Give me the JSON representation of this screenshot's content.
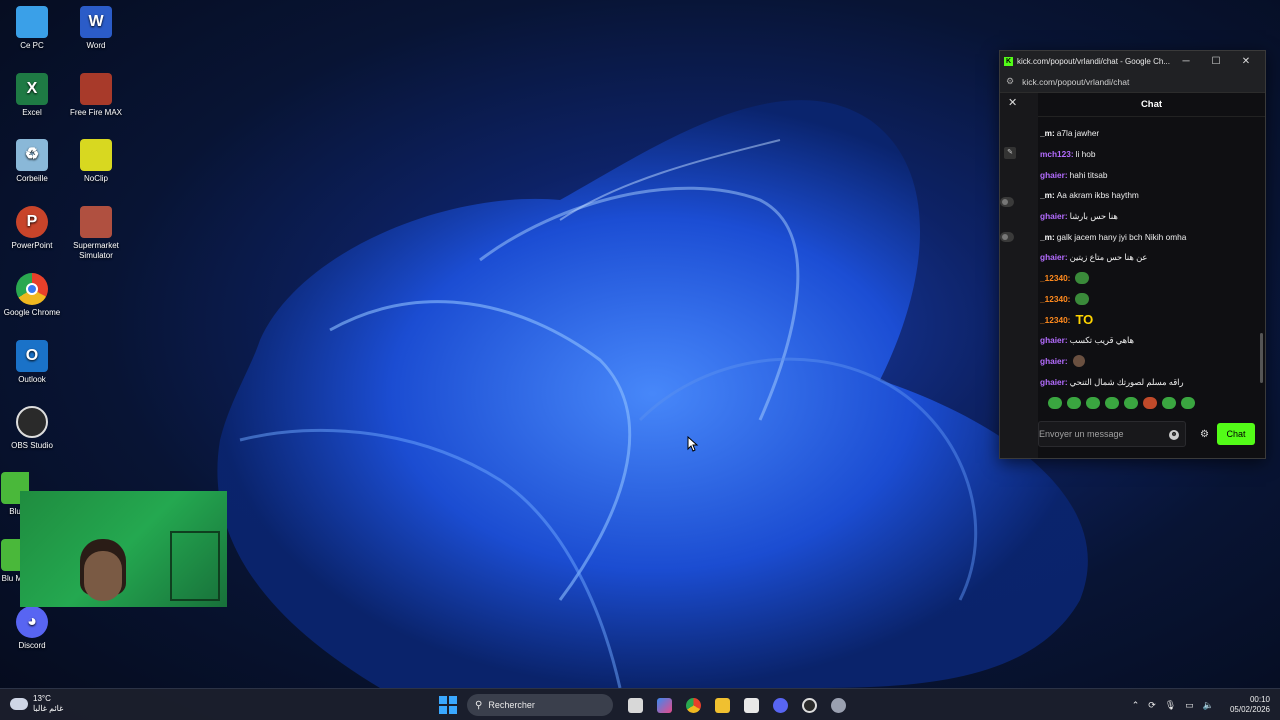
{
  "desktop": {
    "icons": [
      {
        "label": "Ce PC",
        "icon": "monitor-icon",
        "color": "#3aa0e8"
      },
      {
        "label": "Word",
        "icon": "word-icon",
        "color": "#2b5cc8"
      },
      {
        "label": "Excel",
        "icon": "excel-icon",
        "color": "#1e7a44"
      },
      {
        "label": "Free Fire MAX",
        "icon": "free-fire-icon",
        "color": "#a83a2a"
      },
      {
        "label": "Corbeille",
        "icon": "recycle-bin-icon",
        "color": "#8ab8d8"
      },
      {
        "label": "NoClip",
        "icon": "noclip-icon",
        "color": "#d8d820"
      },
      {
        "label": "PowerPoint",
        "icon": "powerpoint-icon",
        "color": "#c8442a"
      },
      {
        "label": "Supermarket Simulator",
        "icon": "supermarket-icon",
        "color": "#b05040"
      },
      {
        "label": "Google Chrome",
        "icon": "chrome-icon",
        "color": "#e8b020"
      },
      {
        "label": "Outlook",
        "icon": "outlook-icon",
        "color": "#1a72c8"
      },
      {
        "label": "OBS Studio",
        "icon": "obs-icon",
        "color": "#2a2a2a"
      },
      {
        "label": "Blu",
        "icon": "bluestacks-icon",
        "color": "#4ab83a"
      },
      {
        "label": "Blu Mul",
        "icon": "bluestacks-multi-icon",
        "color": "#4ab83a"
      },
      {
        "label": "Discord",
        "icon": "discord-icon",
        "color": "#5865f2"
      }
    ],
    "word_letter": "W",
    "excel_letter": "X",
    "powerpoint_letter": "P",
    "outlook_letter": "O"
  },
  "chrome_window": {
    "title": "kick.com/popout/vrlandi/chat - Google Ch...",
    "url": "kick.com/popout/vrlandi/chat",
    "close_symbol": "✕",
    "minimize_symbol": "─",
    "maximize_symbol": "☐"
  },
  "chat": {
    "header": "Chat",
    "messages": [
      {
        "user": "_m",
        "user_color": "#ffffff",
        "text": "a7la jawher"
      },
      {
        "user": "mch123",
        "user_color": "#b46cff",
        "text": "li hob"
      },
      {
        "user": "ghaier",
        "user_color": "#b46cff",
        "text": "hahi titsab"
      },
      {
        "user": "_m",
        "user_color": "#ffffff",
        "text": "Aa akram ikbs haythm"
      },
      {
        "user": "ghaier",
        "user_color": "#b46cff",
        "text": "هنا حس بارشا"
      },
      {
        "user": "_m",
        "user_color": "#ffffff",
        "text": "galk jacem hany jyi bch Nikih omha"
      },
      {
        "user": "ghaier",
        "user_color": "#b46cff",
        "text": "عن هنا حس متاع زيتين"
      },
      {
        "user": "_12340",
        "user_color": "#ff8a1e",
        "text": ""
      },
      {
        "user": "_12340",
        "user_color": "#ff8a1e",
        "text": ""
      },
      {
        "user": "_12340",
        "user_color": "#ff8a1e",
        "text": "",
        "big": "TO"
      },
      {
        "user": "ghaier",
        "user_color": "#b46cff",
        "text": "هاهي قريب تكسب"
      },
      {
        "user": "ghaier",
        "user_color": "#b46cff",
        "text": ""
      },
      {
        "user": "ghaier",
        "user_color": "#b46cff",
        "text": "راقه مسلم لصورتك شمال التنحي"
      }
    ],
    "input_placeholder": "Envoyer un message",
    "send_label": "Chat",
    "accent": "#53fc18"
  },
  "taskbar": {
    "weather_temp": "13°C",
    "weather_desc": "غائم غالبا",
    "search_label": "Rechercher",
    "time": "00:10",
    "date": "05/02/2026"
  }
}
